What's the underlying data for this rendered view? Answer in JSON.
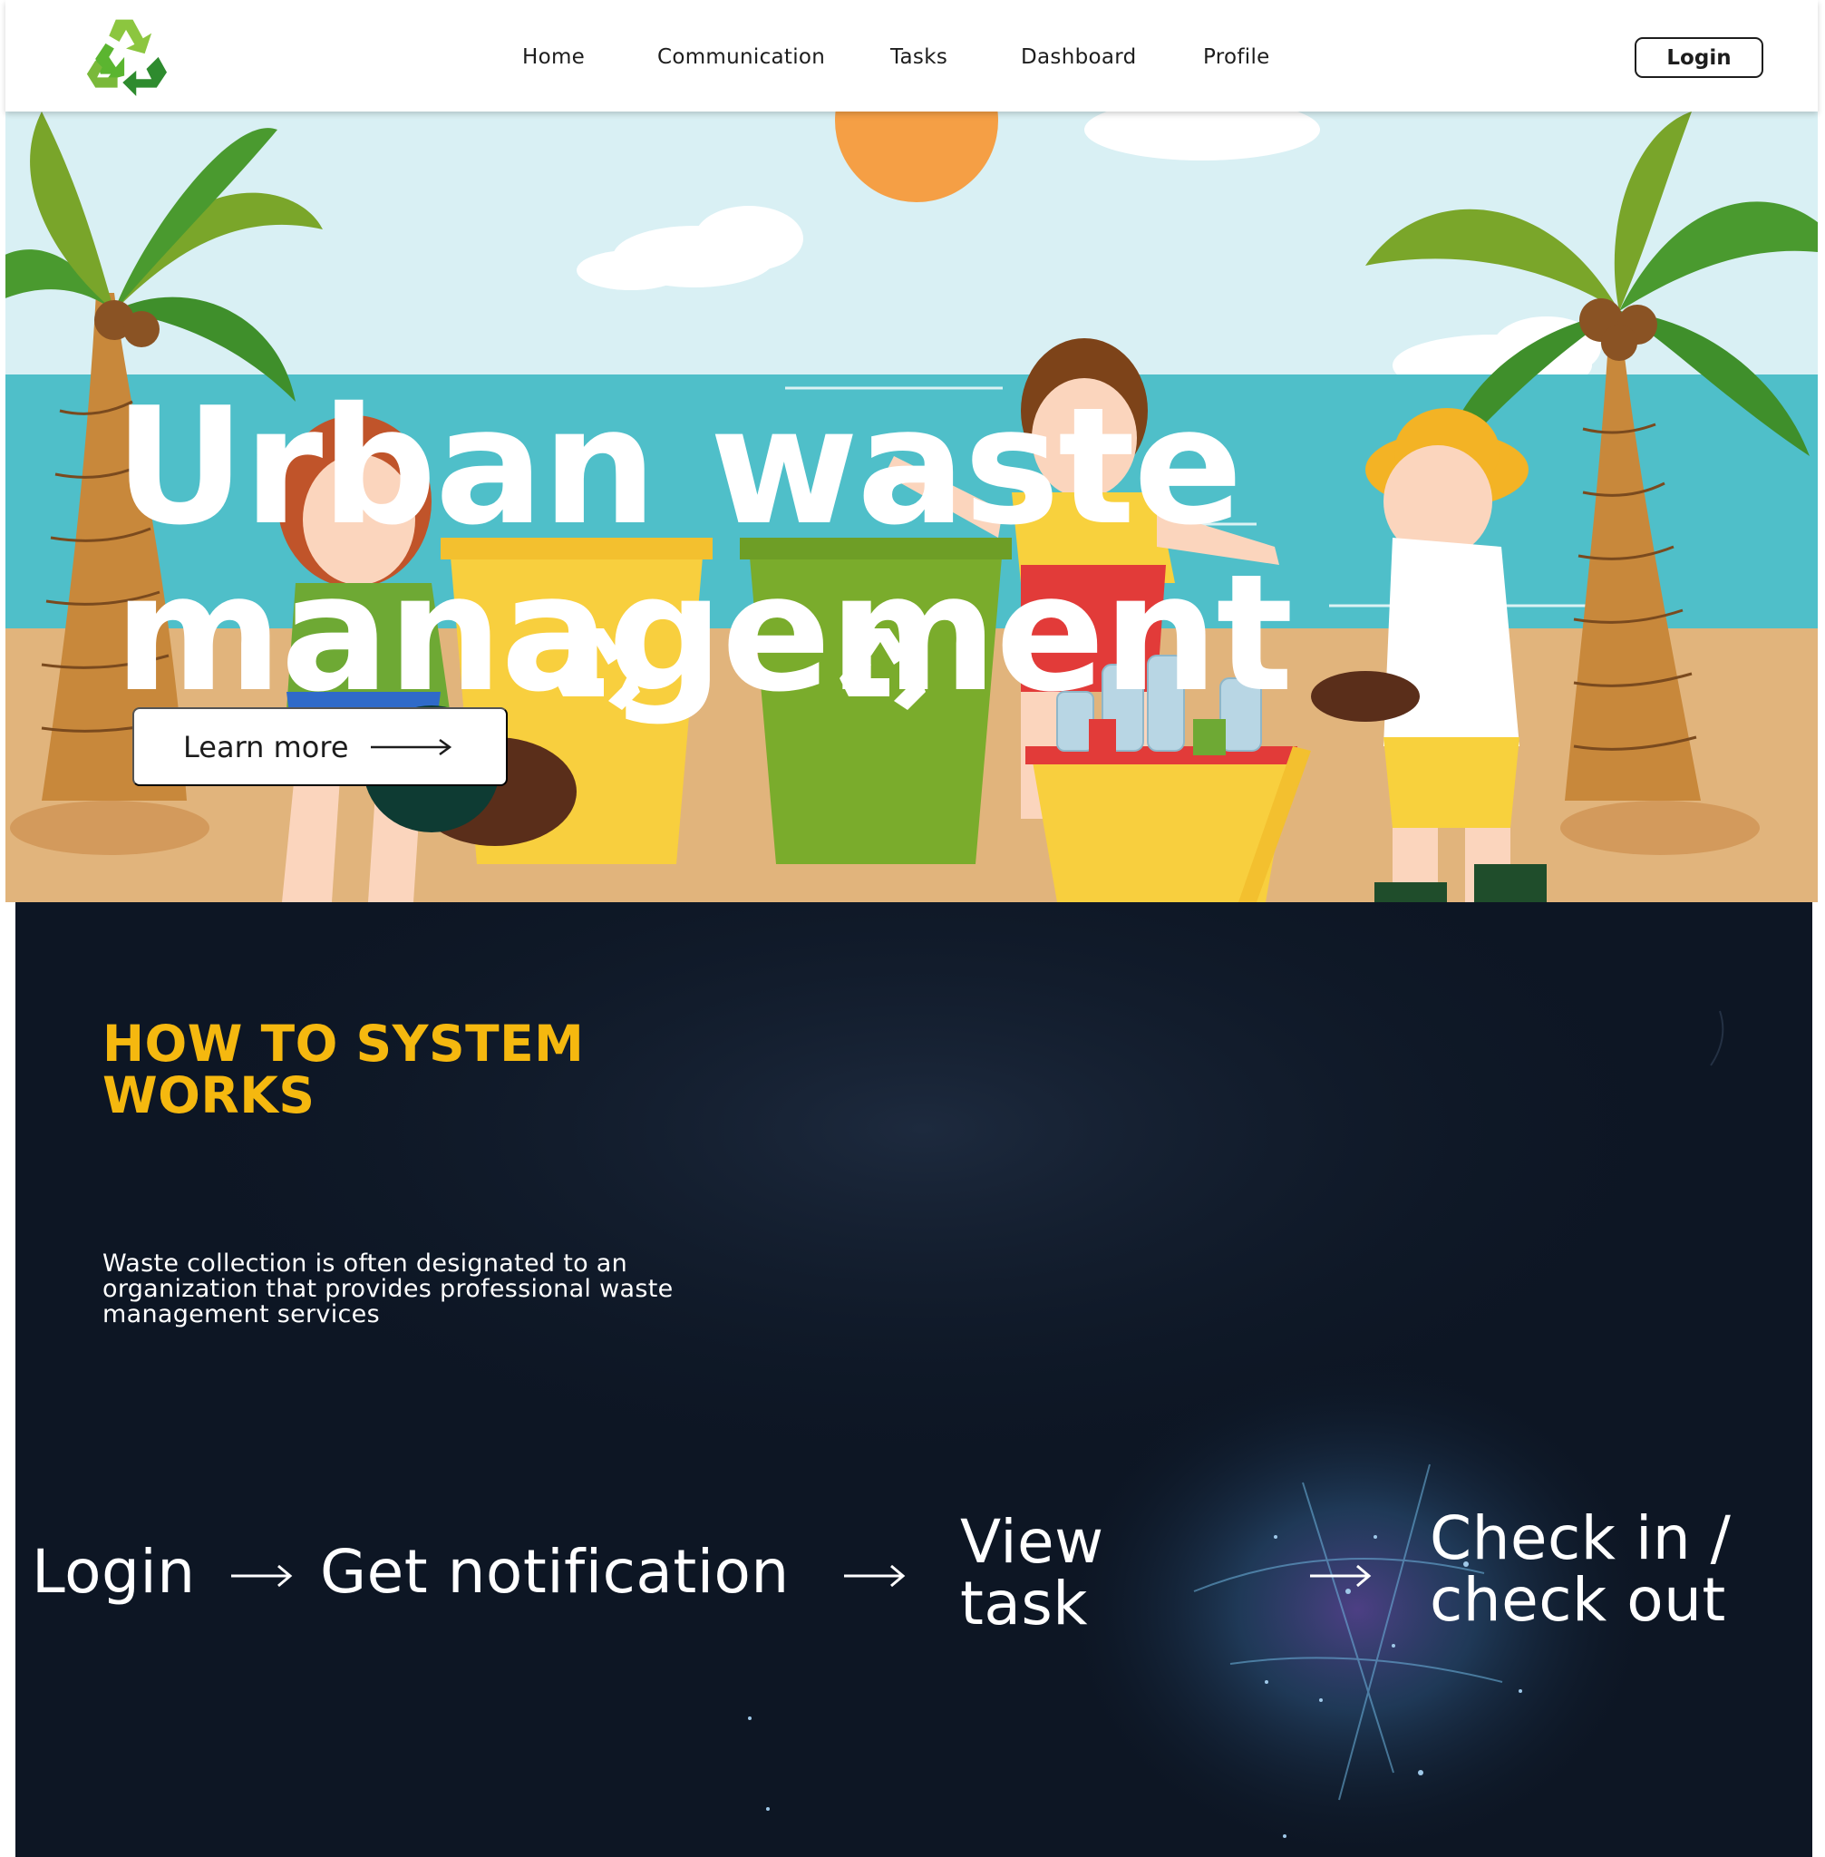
{
  "nav": {
    "links": [
      "Home",
      "Communication",
      "Tasks",
      "Dashboard",
      "Profile"
    ],
    "login_label": "Login",
    "logo_icon": "recycle-icon"
  },
  "hero": {
    "title_line1": "Urban waste",
    "title_line2": "management",
    "cta_label": "Learn more",
    "cta_icon": "long-arrow-right-icon"
  },
  "how": {
    "title": "HOW TO SYSTEM WORKS",
    "description": "Waste collection is often designated to an organization that provides professional waste management services",
    "steps": [
      {
        "line1": "Login",
        "line2": ""
      },
      {
        "line1": "Get notification",
        "line2": ""
      },
      {
        "line1": "View",
        "line2": "task"
      },
      {
        "line1": "Check in /",
        "line2": "check out"
      }
    ],
    "step_icon": "arrow-right-icon"
  },
  "colors": {
    "accent": "#f5b80f",
    "dark_bg": "#0d1624",
    "recycle_green": "#3aa935"
  }
}
